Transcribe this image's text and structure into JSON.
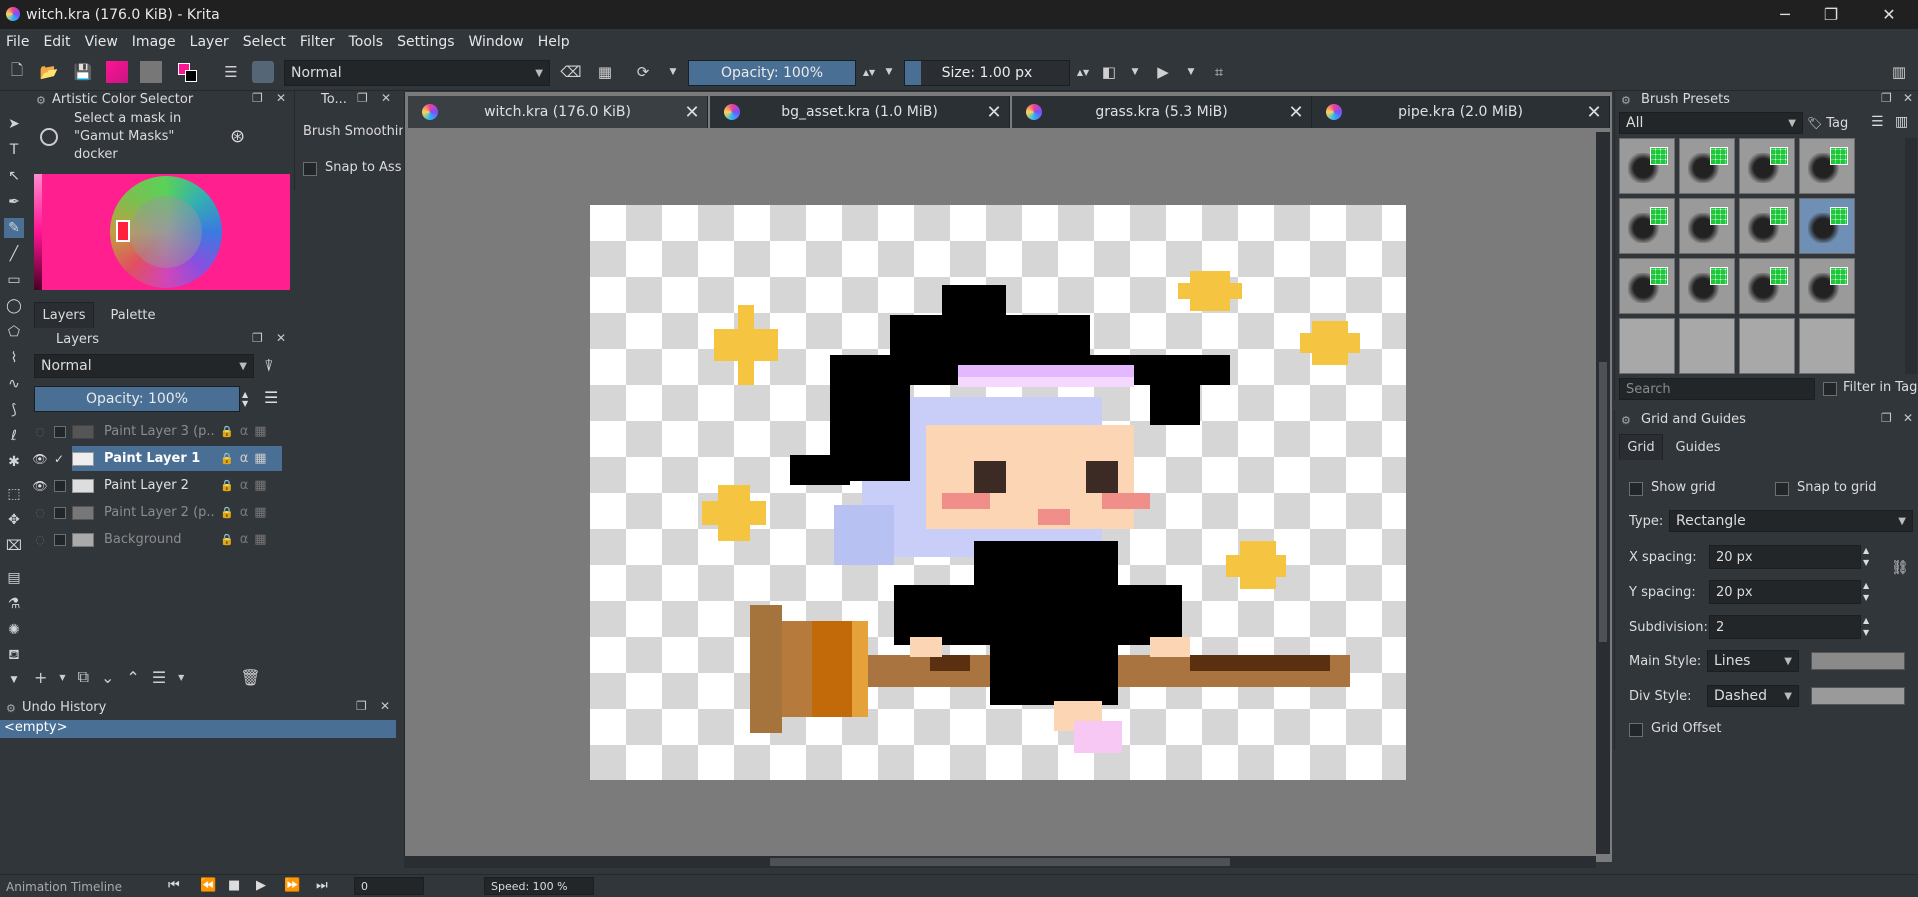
{
  "window": {
    "title": "witch.kra (176.0 KiB)  - Krita"
  },
  "menu": [
    "File",
    "Edit",
    "View",
    "Image",
    "Layer",
    "Select",
    "Filter",
    "Tools",
    "Settings",
    "Window",
    "Help"
  ],
  "toolbar": {
    "blend_mode": "Normal",
    "opacity": "Opacity: 100%",
    "size": "Size: 1.00 px"
  },
  "docs": [
    {
      "label": "witch.kra (176.0 KiB)"
    },
    {
      "label": "bg_asset.kra (1.0 MiB)"
    },
    {
      "label": "grass.kra (5.3 MiB)"
    },
    {
      "label": "pipe.kra (2.0 MiB)"
    }
  ],
  "color_selector": {
    "title": "Artistic Color Selector",
    "hint": "Select a mask in \"Gamut Masks\" docker"
  },
  "tool_options": {
    "title": "To...",
    "brush_smoothing": "Brush Smoothin",
    "snap": "Snap to Ass"
  },
  "layers_tabs": [
    "Layers",
    "Palette"
  ],
  "layers": {
    "title": "Layers",
    "blend": "Normal",
    "opacity": "Opacity:  100%",
    "items": [
      {
        "name": "Paint Layer 3 (p...",
        "visible": false
      },
      {
        "name": "Paint Layer 1",
        "visible": true
      },
      {
        "name": "Paint Layer 2",
        "visible": true
      },
      {
        "name": "Paint Layer 2 (p...",
        "visible": false
      },
      {
        "name": "Background",
        "visible": false
      }
    ]
  },
  "undo": {
    "title": "Undo History",
    "entry": "<empty>"
  },
  "brush_presets": {
    "title": "Brush Presets",
    "filter": "All",
    "tag": "Tag",
    "search_placeholder": "Search",
    "filter_in_tag": "Filter in Tag"
  },
  "grid": {
    "title": "Grid and Guides",
    "tabs": [
      "Grid",
      "Guides"
    ],
    "show_grid": "Show grid",
    "snap_to_grid": "Snap to grid",
    "type_label": "Type:",
    "type_value": "Rectangle",
    "x_label": "X spacing:",
    "x_value": "20 px",
    "y_label": "Y spacing:",
    "y_value": "20 px",
    "sub_label": "Subdivision:",
    "sub_value": "2",
    "main_label": "Main Style:",
    "main_value": "Lines",
    "div_label": "Div Style:",
    "div_value": "Dashed",
    "offset_label": "Grid Offset"
  },
  "bottom": {
    "timeline": "Animation Timeline",
    "frame": "0",
    "speed": "Speed: 100 %"
  },
  "colors": {
    "fg": "#ff1493",
    "wheel_bg": "#ff1f8e",
    "active_layer": "#4a6f95"
  }
}
